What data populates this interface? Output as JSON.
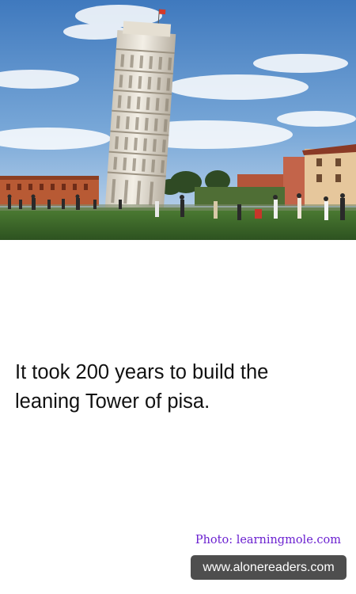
{
  "caption": {
    "line1": "It took 200 years to build the",
    "line2": "leaning Tower of pisa."
  },
  "photo_credit": "Photo: learningmole.com",
  "site_badge": "www.alonereaders.com",
  "colors": {
    "credit_text": "#6a1fd0",
    "badge_background": "#4e4e4e",
    "sky": "#4a86c8",
    "grass": "#3f6b2a"
  }
}
